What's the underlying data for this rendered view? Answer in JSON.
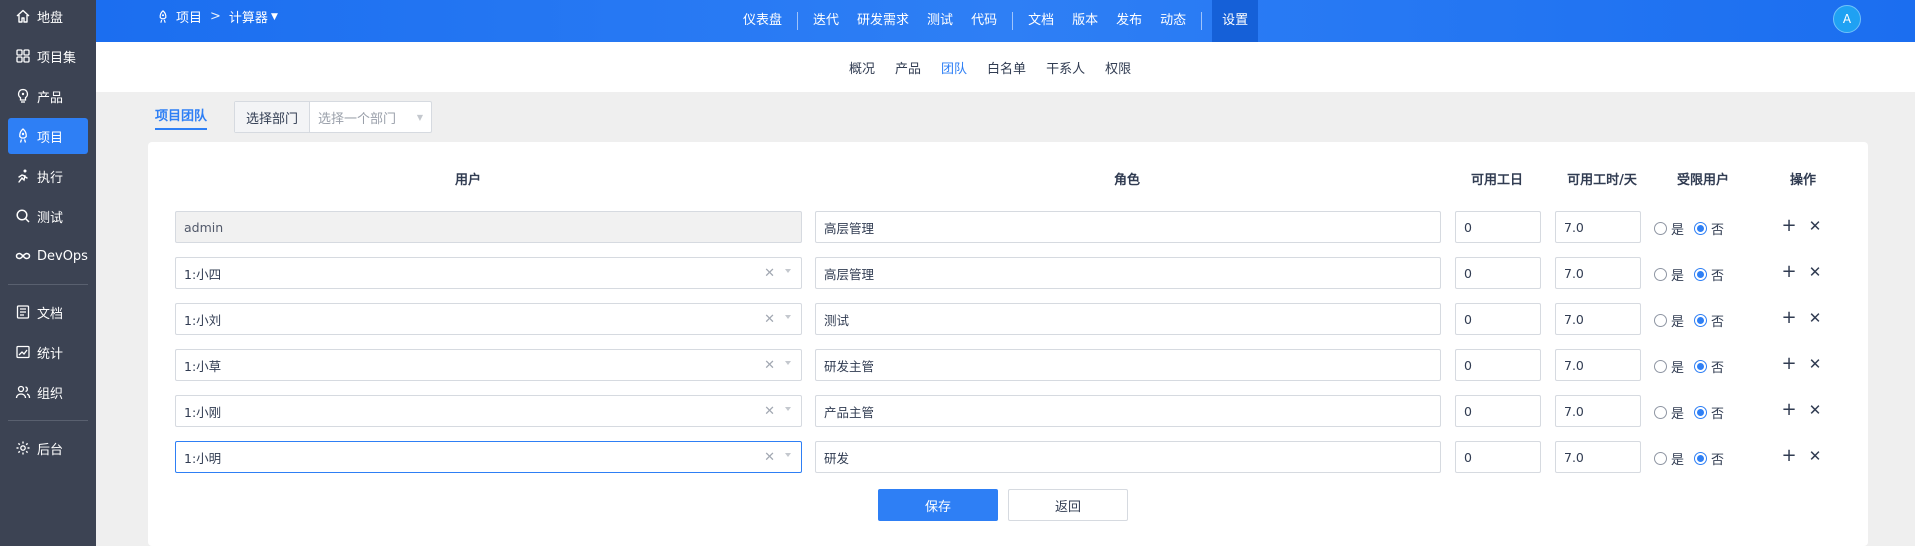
{
  "sidebar": {
    "items": [
      {
        "label": "地盘",
        "icon": "home-icon"
      },
      {
        "label": "项目集",
        "icon": "grid-icon"
      },
      {
        "label": "产品",
        "icon": "lightbulb-icon"
      },
      {
        "label": "项目",
        "icon": "rocket-icon",
        "active": true
      },
      {
        "label": "执行",
        "icon": "run-icon"
      },
      {
        "label": "测试",
        "icon": "magnifier-icon"
      },
      {
        "label": "DevOps",
        "icon": "infinity-icon"
      },
      {
        "label": "文档",
        "icon": "document-icon"
      },
      {
        "label": "统计",
        "icon": "chart-icon"
      },
      {
        "label": "组织",
        "icon": "people-icon"
      },
      {
        "label": "后台",
        "icon": "gear-icon"
      }
    ]
  },
  "header": {
    "breadcrumb": {
      "root": "项目",
      "sep": ">",
      "current": "计算器"
    },
    "nav": [
      "仪表盘",
      "迭代",
      "研发需求",
      "测试",
      "代码",
      "文档",
      "版本",
      "发布",
      "动态"
    ],
    "active": "设置",
    "avatar": "A"
  },
  "subnav": {
    "items": [
      "概况",
      "产品",
      "团队",
      "白名单",
      "干系人",
      "权限"
    ],
    "active_index": 2
  },
  "tabbar": {
    "tab": "项目团队",
    "dept_label": "选择部门",
    "dept_placeholder": "选择一个部门"
  },
  "table": {
    "headers": {
      "user": "用户",
      "role": "角色",
      "days": "可用工日",
      "hours": "可用工时/天",
      "limited": "受限用户",
      "actions": "操作"
    },
    "yes": "是",
    "no": "否",
    "rows": [
      {
        "user": "admin",
        "role": "高层管理",
        "days": "0",
        "hours": "7.0",
        "limited": false,
        "disabled": true
      },
      {
        "user": "1:小四",
        "role": "高层管理",
        "days": "0",
        "hours": "7.0",
        "limited": false
      },
      {
        "user": "1:小刘",
        "role": "测试",
        "days": "0",
        "hours": "7.0",
        "limited": false
      },
      {
        "user": "1:小草",
        "role": "研发主管",
        "days": "0",
        "hours": "7.0",
        "limited": false
      },
      {
        "user": "1:小刚",
        "role": "产品主管",
        "days": "0",
        "hours": "7.0",
        "limited": false
      },
      {
        "user": "1:小明",
        "role": "研发",
        "days": "0",
        "hours": "7.0",
        "limited": false,
        "focused": true
      }
    ]
  },
  "buttons": {
    "save": "保存",
    "back": "返回"
  },
  "colors": {
    "primary": "#2e7ff5",
    "sidebar": "#3c4353"
  }
}
